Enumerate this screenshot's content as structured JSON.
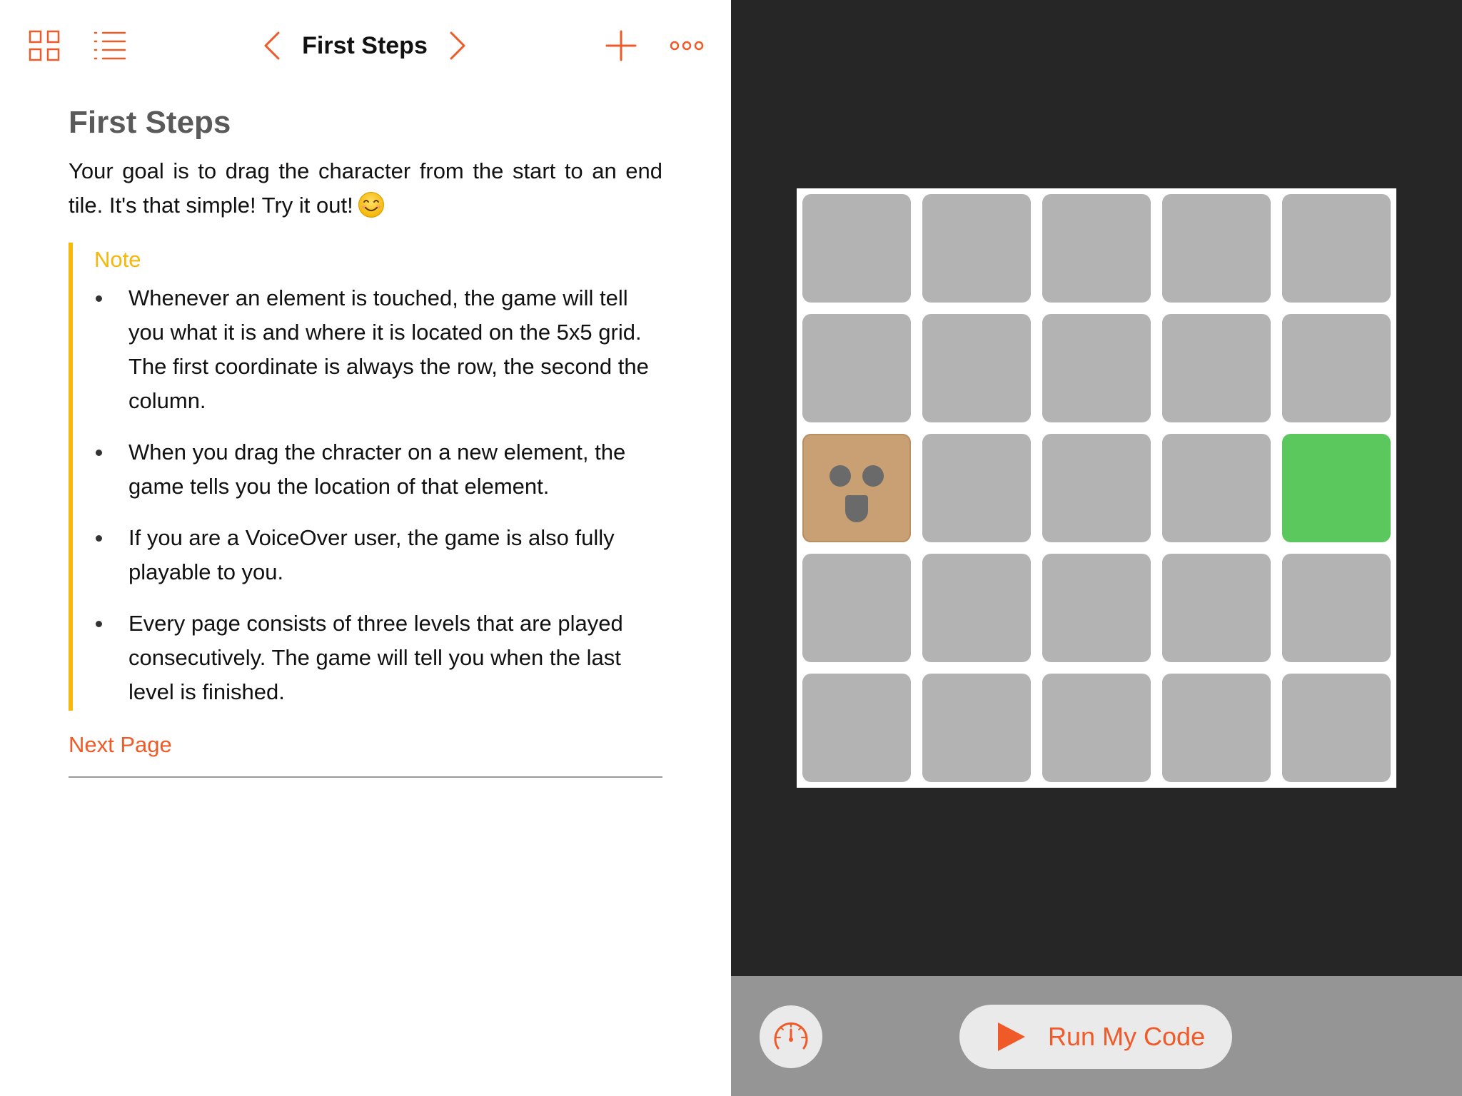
{
  "colors": {
    "accent": "#f05a28",
    "note": "#f5b80b",
    "tile": "#b3b3b3",
    "end_tile": "#5bc85e",
    "character": "#c8a073",
    "stage_bg": "#262626",
    "bottom_bar": "#959595"
  },
  "toolbar": {
    "title": "First Steps",
    "icons": [
      "grid-icon",
      "list-icon",
      "chevron-left-icon",
      "chevron-right-icon",
      "plus-icon",
      "more-icon"
    ]
  },
  "content": {
    "heading": "First Steps",
    "intro": "Your goal is to drag the character from the start to an end tile. It's that simple! Try it out!",
    "intro_emoji": "smiley-face-icon",
    "note": {
      "label": "Note",
      "items": [
        "Whenever an element is touched, the game will tell you what it is and where it is located on the 5x5 grid. The first coordinate is always the row, the second the column.",
        "When you drag the chracter on a new element, the game tells you the location of that element.",
        "If you are a VoiceOver user, the game is also fully playable to you.",
        "Every page consists of three levels that are played consecutively. The game will tell you when the last level is finished."
      ]
    },
    "next_page": "Next Page"
  },
  "game": {
    "rows": 5,
    "cols": 5,
    "start": [
      3,
      1
    ],
    "end": [
      3,
      5
    ]
  },
  "controls": {
    "speed_icon": "speedometer-icon",
    "run_icon": "play-icon",
    "run_label": "Run My Code"
  }
}
